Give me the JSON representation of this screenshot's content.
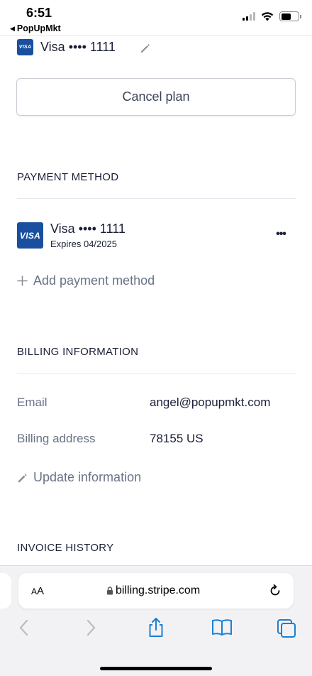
{
  "status_bar": {
    "time": "6:51",
    "back_label": "PopUpMkt"
  },
  "subscription": {
    "card_brand_badge": "VISA",
    "payment_summary": "Visa •••• 1111",
    "cancel_label": "Cancel plan"
  },
  "payment_method": {
    "title": "PAYMENT METHOD",
    "card_badge": "VISA",
    "card_name": "Visa •••• 1111",
    "expires": "Expires 04/2025",
    "more_label": "•••",
    "add_label": "Add payment method"
  },
  "billing": {
    "title": "BILLING INFORMATION",
    "email_label": "Email",
    "email_value": "angel@popupmkt.com",
    "address_label": "Billing address",
    "address_value": "78155 US",
    "update_label": "Update information"
  },
  "invoice": {
    "title": "INVOICE HISTORY"
  },
  "browser": {
    "url": "billing.stripe.com",
    "aa_large": "A",
    "aa_small": "A"
  },
  "colors": {
    "visa_blue": "#1a4fa0",
    "link_gray": "#697386",
    "safari_blue": "#1a7fd4"
  },
  "icons": [
    "pencil-icon",
    "plus-icon",
    "lock-icon",
    "reload-icon",
    "back-icon",
    "forward-icon",
    "share-icon",
    "bookmarks-icon",
    "tabs-icon"
  ]
}
